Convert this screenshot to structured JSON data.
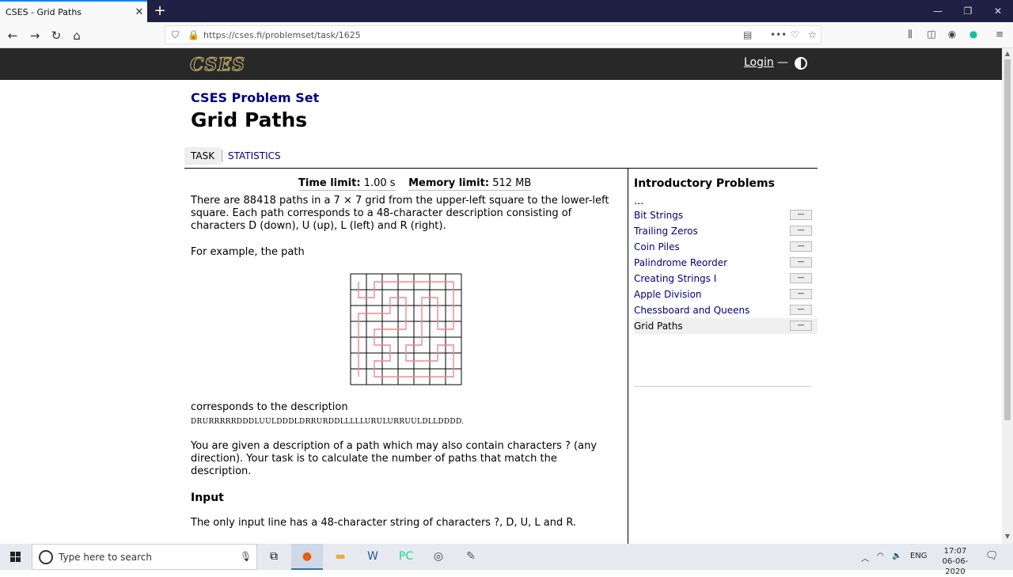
{
  "browser": {
    "tab_title": "CSES - Grid Paths",
    "url": "https://cses.fi/problemset/task/1625",
    "close_glyph": "✕",
    "newtab_glyph": "+"
  },
  "site": {
    "logo": "CSES",
    "login": "Login",
    "dash": "—"
  },
  "breadcrumb": "CSES Problem Set",
  "title": "Grid Paths",
  "tabs": [
    "TASK",
    "STATISTICS"
  ],
  "limits": {
    "time_label": "Time limit:",
    "time_value": "1.00 s",
    "memory_label": "Memory limit:",
    "memory_value": "512 MB"
  },
  "content": {
    "p1": "There are 88418 paths in a 7 × 7 grid from the upper-left square to the lower-left square. Each path corresponds to a 48-character description consisting of characters D (down), U (up), L (left) and R (right).",
    "p2": "For example, the path",
    "p3": "corresponds to the description",
    "example": "DRURRRRRDDDLUULDDDLDRRURDDLLLLLURULURRUULDLLDDDD.",
    "p4": "You are given a description of a path which may also contain characters ? (any direction). Your task is to calculate the number of paths that match the description.",
    "input_heading": "Input",
    "p5": "The only input line has a 48-character string of characters ?, D, U, L and R."
  },
  "sidebar": {
    "title": "Introductory Problems",
    "dots": "...",
    "items": [
      {
        "label": "Bit Strings",
        "stat": "—"
      },
      {
        "label": "Trailing Zeros",
        "stat": "—"
      },
      {
        "label": "Coin Piles",
        "stat": "—"
      },
      {
        "label": "Palindrome Reorder",
        "stat": "—"
      },
      {
        "label": "Creating Strings I",
        "stat": "—"
      },
      {
        "label": "Apple Division",
        "stat": "—"
      },
      {
        "label": "Chessboard and Queens",
        "stat": "—"
      },
      {
        "label": "Grid Paths",
        "stat": "—"
      }
    ]
  },
  "taskbar": {
    "search_placeholder": "Type here to search",
    "language": "ENG",
    "time": "17:07",
    "date": "06-06-2020"
  }
}
